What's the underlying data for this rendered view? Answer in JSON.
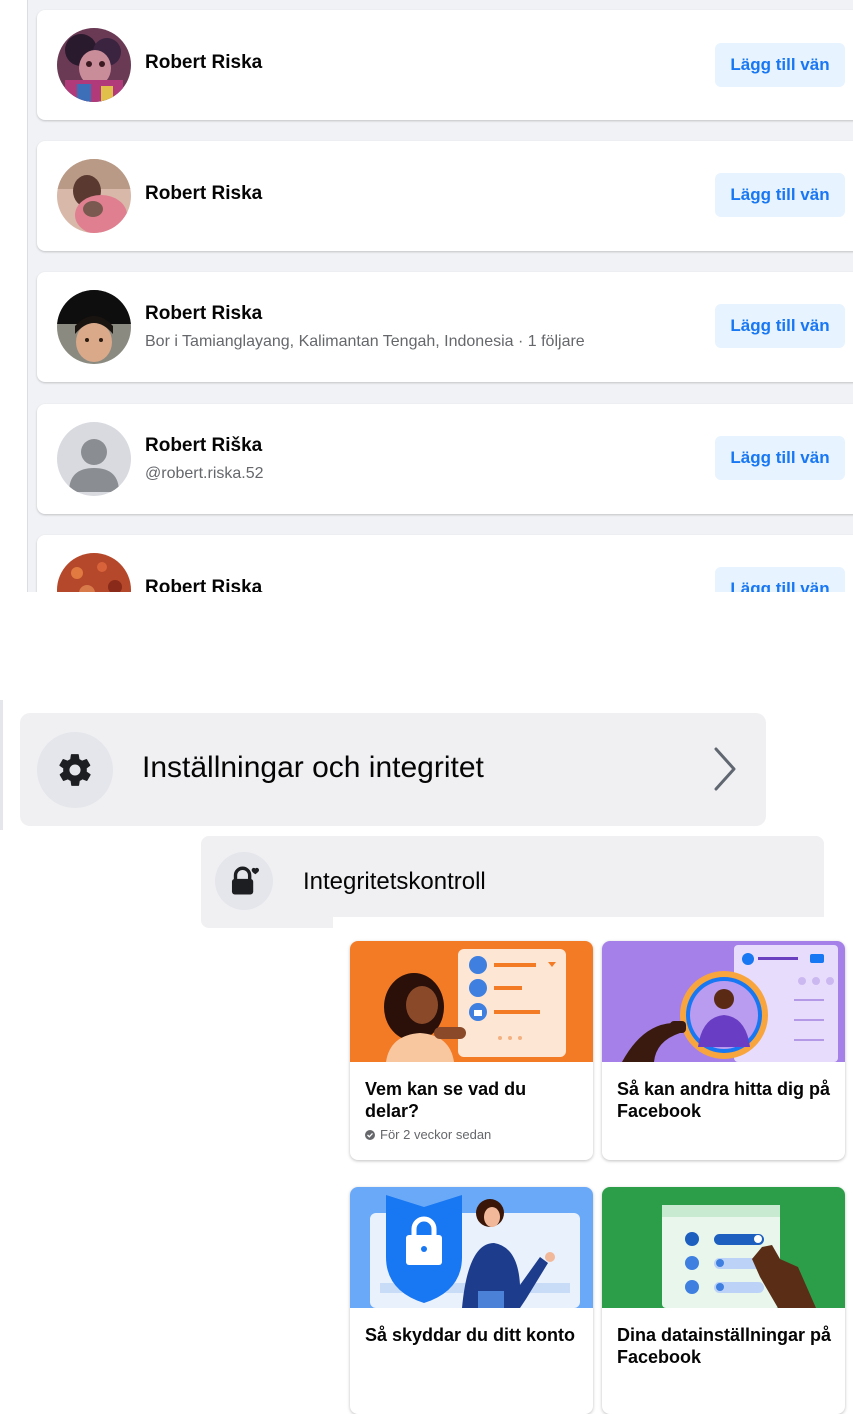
{
  "results": {
    "add_button_label": "Lägg till vän",
    "items": [
      {
        "name": "Robert Riska",
        "subtitle": ""
      },
      {
        "name": "Robert Riska",
        "subtitle": ""
      },
      {
        "name": "Robert Riska",
        "subtitle": "Bor i Tamianglayang, Kalimantan Tengah, Indonesia · 1 följare"
      },
      {
        "name": "Robert Riška",
        "subtitle": "@robert.riska.52"
      },
      {
        "name": "Robert Riska",
        "subtitle": ""
      }
    ]
  },
  "settings_menu": {
    "settings_label": "Inställningar och integritet",
    "privacy_check_label": "Integritetskontroll"
  },
  "privacy_cards": [
    {
      "title": "Vem kan se vad du delar?",
      "meta": "För 2 veckor sedan"
    },
    {
      "title": "Så kan andra hitta dig på Facebook"
    },
    {
      "title": "Så skyddar du ditt konto"
    },
    {
      "title": "Dina datainställningar på Facebook"
    }
  ],
  "colors": {
    "brand_blue": "#1877f2",
    "button_bg": "#e7f3ff",
    "card1_bg": "#f47b26",
    "card2_bg": "#a580e9",
    "card3_bg": "#6aa9f7",
    "card4_bg": "#2c9e49"
  },
  "icons": {
    "settings": "gear-icon",
    "chevron": "chevron-right-icon",
    "privacy_check": "lock-heart-icon"
  }
}
